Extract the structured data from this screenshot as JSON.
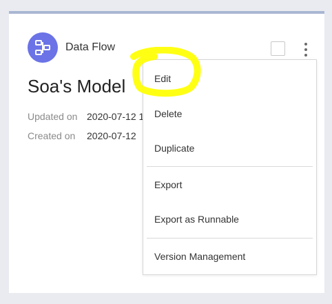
{
  "card": {
    "type_label": "Data Flow",
    "type_icon": "data-flow-icon",
    "title": "Soa's Model",
    "updated_label": "Updated on",
    "updated_value": "2020-07-12 1",
    "created_label": "Created on",
    "created_value": "2020-07-12"
  },
  "menu": {
    "items": [
      {
        "label": "Edit"
      },
      {
        "label": "Delete"
      },
      {
        "label": "Duplicate"
      },
      {
        "label": "Export"
      },
      {
        "label": "Export as Runnable"
      },
      {
        "label": "Version Management"
      }
    ]
  },
  "colors": {
    "accent": "#6b73e6",
    "highlight": "#ffff00",
    "card_top_border": "#a9b7d3"
  }
}
